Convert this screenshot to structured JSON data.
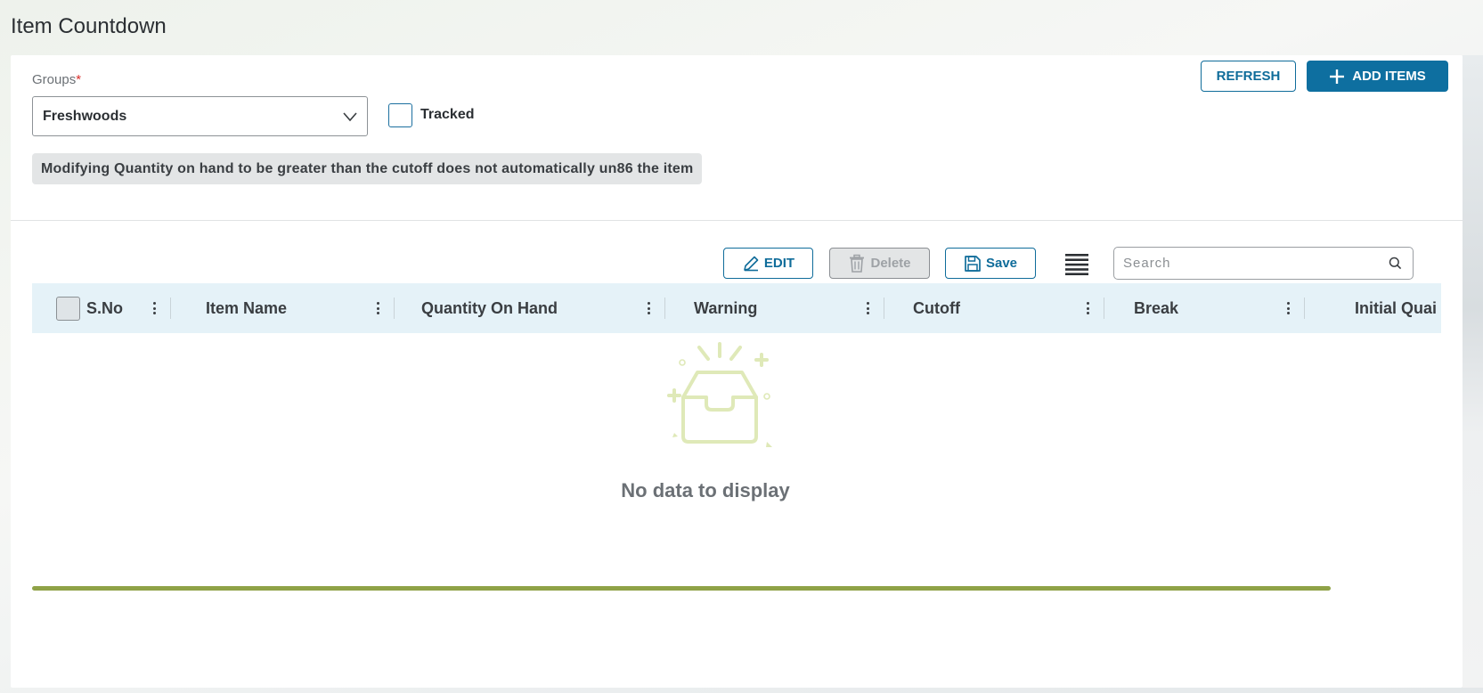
{
  "page": {
    "title": "Item Countdown"
  },
  "filters": {
    "groups_label": "Groups",
    "required_mark": "*",
    "group_value": "Freshwoods",
    "tracked_label": "Tracked",
    "tracked_checked": false,
    "notice": "Modifying Quantity on hand to be greater than the cutoff does not automatically un86 the item"
  },
  "actions": {
    "refresh_label": "REFRESH",
    "add_items_label": "ADD ITEMS"
  },
  "toolbar": {
    "edit_label": "EDIT",
    "delete_label": "Delete",
    "save_label": "Save",
    "search_placeholder": "Search"
  },
  "grid": {
    "columns": [
      {
        "label": "S.No"
      },
      {
        "label": "Item Name"
      },
      {
        "label": "Quantity On Hand"
      },
      {
        "label": "Warning"
      },
      {
        "label": "Cutoff"
      },
      {
        "label": "Break"
      },
      {
        "label": "Initial Quai"
      }
    ],
    "empty_text": "No data to display"
  },
  "colors": {
    "primary": "#0e6fa0",
    "header_bg": "#e5f2f8",
    "progress": "#8fa247",
    "empty_illustration": "#dfe9b8"
  }
}
